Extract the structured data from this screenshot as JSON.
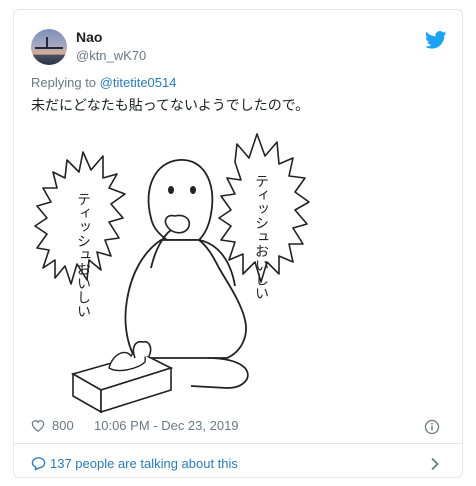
{
  "tweet": {
    "display_name": "Nao",
    "handle": "@ktn_wK70",
    "replying_prefix": "Replying to",
    "replying_to": "@titetite0514",
    "text": "未だにどなたも貼ってないようでしたので。",
    "likes": "800",
    "timestamp": "10:06 PM - Dec 23, 2019",
    "talking": "137 people are talking about this"
  },
  "media": {
    "left_bubble_text": "ティッシュおいしい",
    "right_bubble_text": "ティッシュおいしい"
  },
  "icons": {
    "brand": "twitter-bird-icon",
    "like": "heart-icon",
    "info": "info-icon",
    "conversation": "speech-bubble-icon",
    "expand": "chevron-right-icon"
  },
  "colors": {
    "brand": "#1da1f2",
    "link": "#2b7bb9",
    "muted": "#697882",
    "text": "#1c2022",
    "border": "#e1e8ed"
  }
}
